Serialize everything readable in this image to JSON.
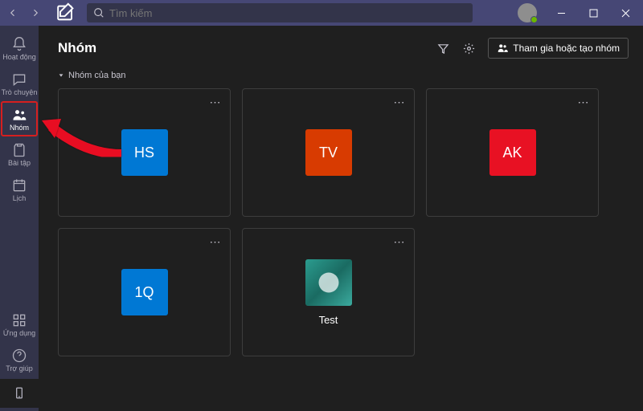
{
  "search": {
    "placeholder": "Tìm kiếm"
  },
  "rail": {
    "activity": "Hoạt động",
    "chat": "Trò chuyện",
    "teams": "Nhóm",
    "assignments": "Bài tập",
    "calendar": "Lịch",
    "apps": "Ứng dụng",
    "help": "Trợ giúp"
  },
  "header": {
    "title": "Nhóm",
    "join_button": "Tham gia hoặc tạo nhóm"
  },
  "section": {
    "your_teams": "Nhóm của bạn"
  },
  "teams": [
    {
      "initials": "HS",
      "color": "#0078d4",
      "name": ""
    },
    {
      "initials": "TV",
      "color": "#d83b01",
      "name": ""
    },
    {
      "initials": "AK",
      "color": "#e81123",
      "name": ""
    },
    {
      "initials": "1Q",
      "color": "#0078d4",
      "name": ""
    },
    {
      "initials": "",
      "color": "#2b9c8f",
      "name": "Test",
      "hasImage": true
    }
  ]
}
